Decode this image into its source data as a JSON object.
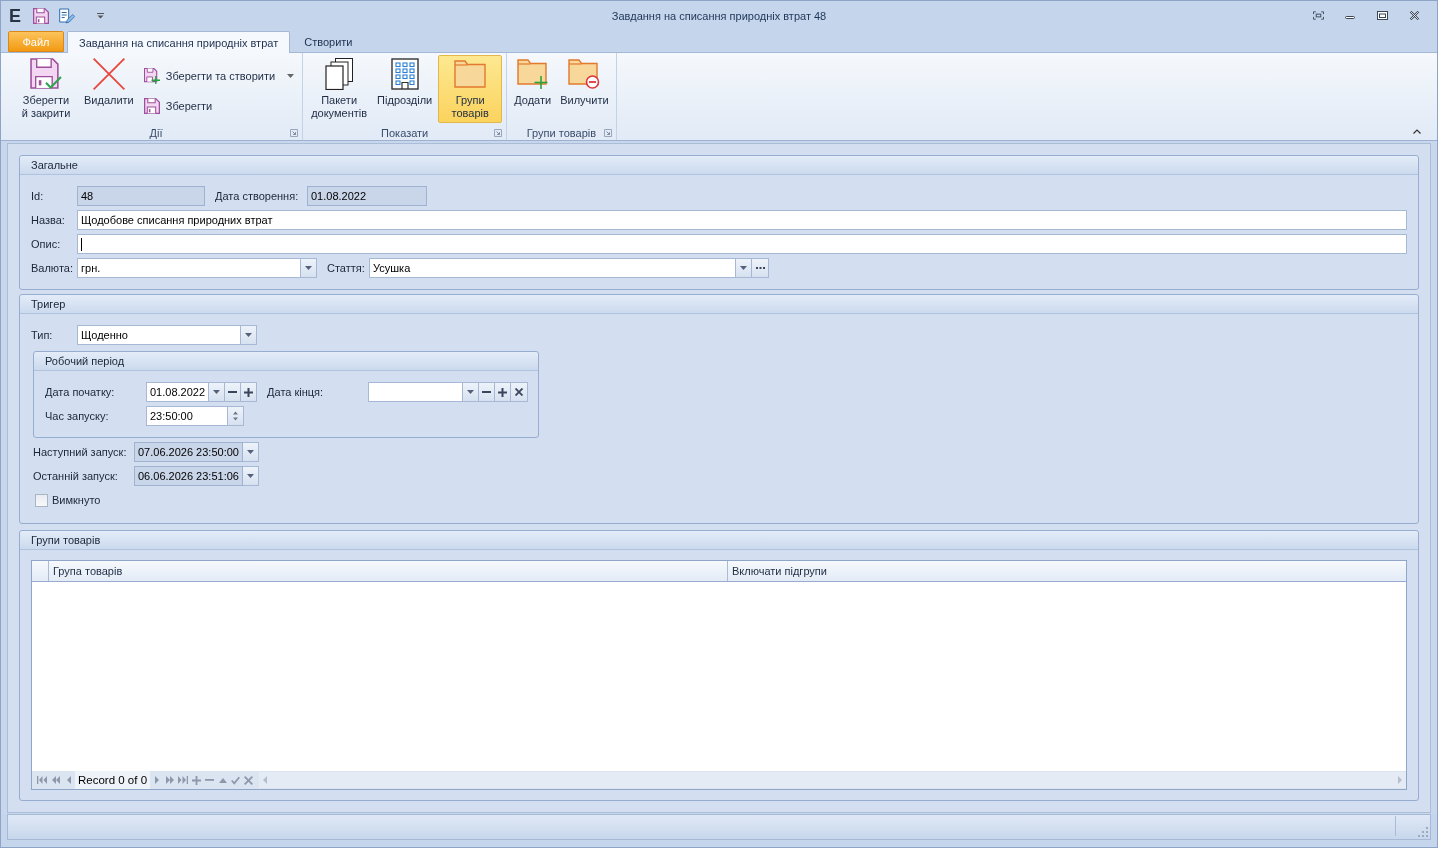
{
  "window": {
    "logo": "E",
    "title": "Завдання на списання природніх втрат 48"
  },
  "ribbon": {
    "tabs": [
      {
        "label": "Файл",
        "kind": "application",
        "selected": false
      },
      {
        "label": "Завдання на списання природніх втрат",
        "kind": "page",
        "selected": true
      },
      {
        "label": "Створити",
        "kind": "page",
        "selected": false
      }
    ],
    "groups": [
      {
        "title": "Дії",
        "items": [
          {
            "label": "Зберегти й закрити",
            "kind": "large"
          },
          {
            "label": "Видалити",
            "kind": "large"
          },
          {
            "label": "Зберегти та створити",
            "kind": "small-split"
          },
          {
            "label": "Зберегти",
            "kind": "small"
          }
        ]
      },
      {
        "title": "Показати",
        "items": [
          {
            "label": "Пакети документів",
            "kind": "large",
            "selected": false
          },
          {
            "label": "Підрозділи",
            "kind": "large",
            "selected": false
          },
          {
            "label": "Групи товарів",
            "kind": "large",
            "selected": true
          }
        ]
      },
      {
        "title": "Групи товарів",
        "items": [
          {
            "label": "Додати",
            "kind": "large"
          },
          {
            "label": "Вилучити",
            "kind": "large"
          }
        ]
      }
    ]
  },
  "general": {
    "title": "Загальне",
    "id": {
      "label": "Id:",
      "value": "48",
      "read_only": true
    },
    "created": {
      "label": "Дата створення:",
      "value": "01.08.2022",
      "read_only": true
    },
    "name": {
      "label": "Назва:",
      "value": "Щодобове списання природних втрат",
      "read_only": false
    },
    "description": {
      "label": "Опис:",
      "read_only": false,
      "focused": true
    },
    "currency": {
      "label": "Валюта:",
      "value": "грн.",
      "read_only": false
    },
    "article": {
      "label": "Стаття:",
      "value": "Усушка",
      "read_only": false
    }
  },
  "trigger": {
    "title": "Тригер",
    "type": {
      "label": "Тип:",
      "value": "Щоденно",
      "read_only": false
    },
    "working_period": {
      "title": "Робочий період",
      "start_date": {
        "label": "Дата початку:",
        "value": "01.08.2022",
        "read_only": false
      },
      "end_date": {
        "label": "Дата кінця:",
        "read_only": false
      },
      "launch_time": {
        "label": "Час запуску:",
        "value": "23:50:00",
        "read_only": false
      }
    },
    "next_run": {
      "label": "Наступний запуск:",
      "value": "07.06.2026 23:50:00",
      "read_only": true
    },
    "last_run": {
      "label": "Останній запуск:",
      "value": "06.06.2026 23:51:06",
      "read_only": true
    },
    "disabled": {
      "label": "Вимкнуто",
      "checked": false
    }
  },
  "product_groups": {
    "title": "Групи товарів",
    "table": {
      "columns": [
        "Група товарів",
        "Включати підгрупи"
      ]
    },
    "navigator": {
      "record_text": "Record 0 of 0"
    }
  }
}
